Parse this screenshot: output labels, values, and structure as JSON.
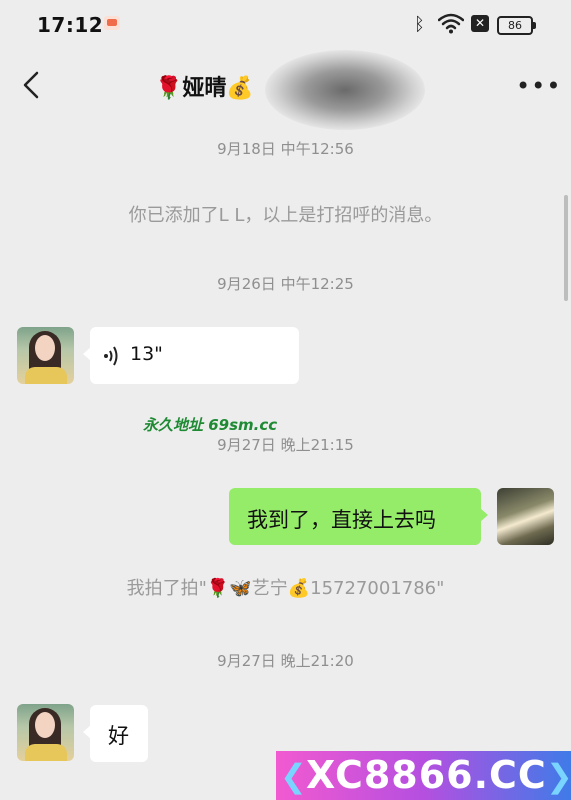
{
  "status_bar": {
    "time": "17:12",
    "battery": "86",
    "icons": [
      "app-notification-icon",
      "bluetooth-icon",
      "wifi-icon",
      "close-box-icon",
      "battery-icon"
    ]
  },
  "header": {
    "title": "🌹娅晴💰",
    "back_icon": "chevron-left-icon",
    "more_label": "•••"
  },
  "messages": [
    {
      "type": "timestamp",
      "text": "9月18日 中午12:56"
    },
    {
      "type": "system",
      "text": "你已添加了L L，以上是打招呼的消息。"
    },
    {
      "type": "timestamp",
      "text": "9月26日 中午12:25"
    },
    {
      "type": "voice",
      "direction": "incoming",
      "duration": "13\""
    },
    {
      "type": "timestamp",
      "text": "9月27日 晚上21:15"
    },
    {
      "type": "text",
      "direction": "outgoing",
      "text": "我到了，直接上去吗"
    },
    {
      "type": "system",
      "text": "我拍了拍\"🌹🦋艺宁💰15727001786\""
    },
    {
      "type": "timestamp",
      "text": "9月27日 晚上21:20"
    },
    {
      "type": "text",
      "direction": "incoming",
      "text": "好"
    }
  ],
  "watermarks": {
    "site_text": "永久地址 69sm.cc",
    "banner_text": "XC8866.CC",
    "chevron_left": "❮",
    "chevron_right": "❯"
  },
  "colors": {
    "background": "#ededed",
    "incoming_bubble": "#ffffff",
    "outgoing_bubble": "#95ec69",
    "timestamp_text": "#8f8f8f"
  }
}
